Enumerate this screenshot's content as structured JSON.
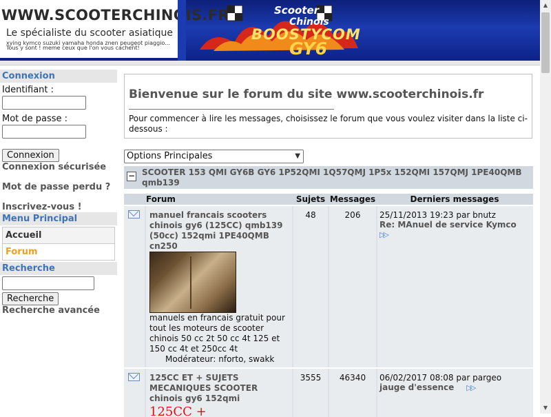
{
  "header": {
    "site_name": "WWW.SCOOTERCHINOIS.FR",
    "tagline": "Le spécialiste du scooter asiatique",
    "brands_line": "xying kymco suzuki yamaha honda znen peugeot piaggio...",
    "slogan_line": "Tous y sont ! meme ceux que l'on vous cachent!",
    "logo_text_1": "Scooter",
    "logo_text_2": "Chinois",
    "logo_text_3": "BOOSTYCOM",
    "logo_text_4": "GY6"
  },
  "sidebar": {
    "login_title": "Connexion",
    "username_label": "Identifiant :",
    "username_value": "",
    "password_label": "Mot de passe :",
    "password_value": "",
    "login_button": "Connexion",
    "secure_login": "Connexion sécurisée",
    "lost_password": "Mot de passe perdu ?",
    "register": "Inscrivez-vous !",
    "menu_title": "Menu Principal",
    "menu_items": [
      "Accueil",
      "Forum"
    ],
    "search_title": "Recherche",
    "search_value": "",
    "search_button": "Recherche",
    "advanced_search": "Recherche avancée"
  },
  "welcome": {
    "title": "Bienvenue sur le forum du site www.scooterchinois.fr",
    "text": "Pour commencer à lire les messages, choisissez le forum que vous voulez visiter dans la liste ci-dessous :"
  },
  "options_select": "Options Principales",
  "category": {
    "toggle": "−",
    "title": "SCOOTER 153 QMI GY6B GY6 1P52QMI 1Q57QMJ 1P5x 152QMI 157QMJ 1PE40QMB qmb139"
  },
  "table": {
    "headers": [
      "Forum",
      "Sujets",
      "Messages",
      "Derniers messages"
    ],
    "rows": [
      {
        "name": "manuel francais scooters chinois gy6 (125CC) qmb139 (50cc) 152qmi 1PE40QMB cn250",
        "description": "manuels en francais gratuit pour tout les moteurs de scooter chinois 50 cc 2t 50 cc 4t 125 et 150 cc 4t et 250cc 4t",
        "moderators": "Modérateur: nforto, swakk",
        "topics": "48",
        "messages": "206",
        "last_date": "25/11/2013 19:23 par bnutz",
        "last_title": "Re: MAnuel de service Kymco"
      },
      {
        "name": "125CC ET + SUJETS MECANIQUES SCOOTER chinois gy6 152qmi",
        "image_text": "125CC +",
        "topics": "3555",
        "messages": "46340",
        "last_date": "06/02/2017 08:08 par pargeo",
        "last_title": "jauge d'essence"
      }
    ]
  },
  "colors": {
    "header_blue": "#1c3bb0",
    "sidebar_title": "#3f73b8",
    "menu_active": "#f0a020",
    "table_header": "#d2d8e0"
  }
}
